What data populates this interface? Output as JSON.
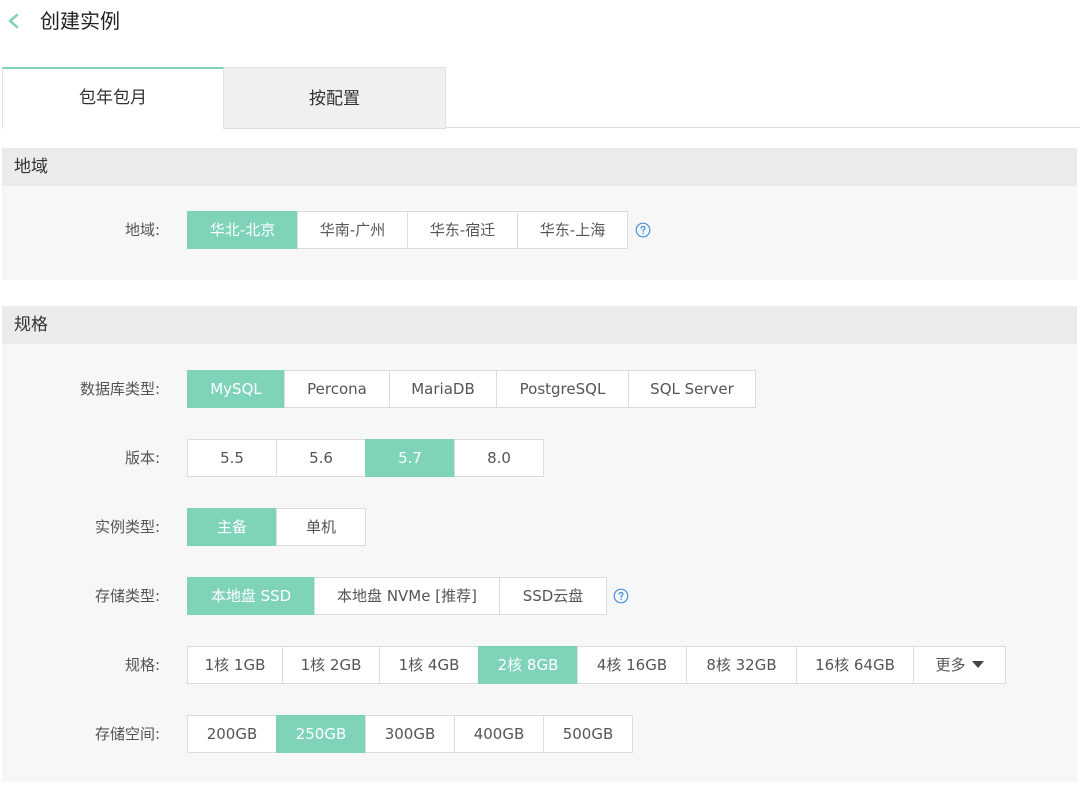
{
  "header": {
    "title": "创建实例"
  },
  "tabs": [
    {
      "label": "包年包月",
      "active": true
    },
    {
      "label": "按配置",
      "active": false
    }
  ],
  "sections": {
    "region": {
      "title": "地域",
      "label": "地域:",
      "options": [
        "华北-北京",
        "华南-广州",
        "华东-宿迁",
        "华东-上海"
      ],
      "selected": "华北-北京"
    },
    "spec": {
      "title": "规格",
      "db_type": {
        "label": "数据库类型:",
        "options": [
          "MySQL",
          "Percona",
          "MariaDB",
          "PostgreSQL",
          "SQL Server"
        ],
        "selected": "MySQL"
      },
      "version": {
        "label": "版本:",
        "options": [
          "5.5",
          "5.6",
          "5.7",
          "8.0"
        ],
        "selected": "5.7"
      },
      "instance_type": {
        "label": "实例类型:",
        "options": [
          "主备",
          "单机"
        ],
        "selected": "主备"
      },
      "storage_type": {
        "label": "存储类型:",
        "options": [
          "本地盘 SSD",
          "本地盘 NVMe [推荐]",
          "SSD云盘"
        ],
        "selected": "本地盘 SSD"
      },
      "spec_size": {
        "label": "规格:",
        "options": [
          "1核 1GB",
          "1核 2GB",
          "1核 4GB",
          "2核 8GB",
          "4核 16GB",
          "8核 32GB",
          "16核 64GB"
        ],
        "selected": "2核 8GB",
        "more_label": "更多"
      },
      "storage_space": {
        "label": "存储空间:",
        "options": [
          "200GB",
          "250GB",
          "300GB",
          "400GB",
          "500GB"
        ],
        "selected": "250GB"
      }
    }
  },
  "colors": {
    "accent": "#7ed3b8",
    "help_icon": "#4a90d9",
    "back_icon": "#7ed3b8"
  },
  "icons": {
    "back": "chevron-left-icon",
    "help": "question-circle-icon",
    "more": "caret-down-icon"
  }
}
